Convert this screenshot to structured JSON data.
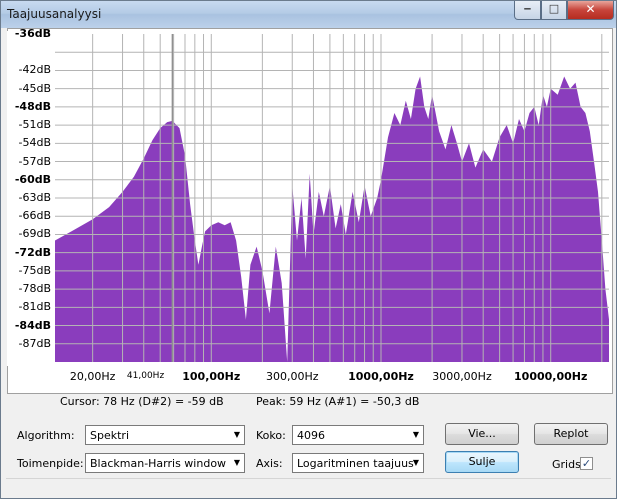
{
  "window": {
    "title": "Taajuusanalyysi",
    "minimize_glyph": "‒",
    "maximize_glyph": "□",
    "close_glyph": "✕"
  },
  "plot": {
    "fill_color": "#8a3dbd",
    "grid_color": "#b4b4b4",
    "y_ticks": [
      {
        "label": "-36dB",
        "bold": true
      },
      {
        "label": "-42dB",
        "bold": false
      },
      {
        "label": "-45dB",
        "bold": false
      },
      {
        "label": "-48dB",
        "bold": true
      },
      {
        "label": "-51dB",
        "bold": false
      },
      {
        "label": "-54dB",
        "bold": false
      },
      {
        "label": "-57dB",
        "bold": false
      },
      {
        "label": "-60dB",
        "bold": true
      },
      {
        "label": "-63dB",
        "bold": false
      },
      {
        "label": "-66dB",
        "bold": false
      },
      {
        "label": "-69dB",
        "bold": false
      },
      {
        "label": "-72dB",
        "bold": true
      },
      {
        "label": "-75dB",
        "bold": false
      },
      {
        "label": "-78dB",
        "bold": false
      },
      {
        "label": "-81dB",
        "bold": false
      },
      {
        "label": "-84dB",
        "bold": true
      },
      {
        "label": "-87dB",
        "bold": false
      }
    ],
    "x_ticks": [
      {
        "label": "20,00Hz",
        "style": "normal",
        "freq": 20
      },
      {
        "label": "41,00Hz",
        "style": "small",
        "freq": 41
      },
      {
        "label": "100,00Hz",
        "style": "bold",
        "freq": 100
      },
      {
        "label": "300,00Hz",
        "style": "normal",
        "freq": 300
      },
      {
        "label": "1000,00Hz",
        "style": "bold",
        "freq": 1000
      },
      {
        "label": "3000,00Hz",
        "style": "normal",
        "freq": 3000
      },
      {
        "label": "10000,00Hz",
        "style": "bold",
        "freq": 10000
      }
    ]
  },
  "chart_data": {
    "type": "area",
    "x_scale": "log",
    "x_range_hz": [
      12,
      22050
    ],
    "y_range_db": [
      -90,
      -36
    ],
    "grid": true,
    "cursor_freq_hz": 59,
    "spectrum": [
      [
        12,
        -70
      ],
      [
        15,
        -68.5
      ],
      [
        20,
        -66.5
      ],
      [
        25,
        -64.5
      ],
      [
        30,
        -62
      ],
      [
        35,
        -59.5
      ],
      [
        40,
        -56.5
      ],
      [
        45,
        -53.5
      ],
      [
        50,
        -51.5
      ],
      [
        55,
        -50.5
      ],
      [
        59,
        -50.3
      ],
      [
        65,
        -51.5
      ],
      [
        70,
        -56
      ],
      [
        75,
        -64
      ],
      [
        80,
        -70
      ],
      [
        84,
        -74
      ],
      [
        88,
        -71
      ],
      [
        92,
        -68.5
      ],
      [
        100,
        -67.5
      ],
      [
        110,
        -67
      ],
      [
        120,
        -67.5
      ],
      [
        130,
        -67
      ],
      [
        140,
        -70
      ],
      [
        150,
        -76
      ],
      [
        160,
        -83
      ],
      [
        170,
        -74
      ],
      [
        185,
        -71
      ],
      [
        200,
        -75
      ],
      [
        220,
        -82
      ],
      [
        240,
        -71
      ],
      [
        260,
        -77
      ],
      [
        280,
        -90
      ],
      [
        300,
        -61
      ],
      [
        320,
        -70
      ],
      [
        340,
        -63
      ],
      [
        360,
        -73
      ],
      [
        380,
        -59
      ],
      [
        400,
        -69
      ],
      [
        430,
        -62
      ],
      [
        460,
        -66
      ],
      [
        500,
        -61
      ],
      [
        540,
        -68
      ],
      [
        580,
        -64
      ],
      [
        620,
        -69
      ],
      [
        680,
        -62
      ],
      [
        740,
        -67
      ],
      [
        800,
        -61
      ],
      [
        870,
        -66
      ],
      [
        950,
        -63
      ],
      [
        1000,
        -60
      ],
      [
        1100,
        -53
      ],
      [
        1200,
        -49
      ],
      [
        1300,
        -51
      ],
      [
        1400,
        -47
      ],
      [
        1500,
        -50
      ],
      [
        1600,
        -45
      ],
      [
        1700,
        -43
      ],
      [
        1800,
        -48
      ],
      [
        1900,
        -50
      ],
      [
        2000,
        -46
      ],
      [
        2200,
        -52
      ],
      [
        2400,
        -55
      ],
      [
        2600,
        -51
      ],
      [
        2800,
        -54
      ],
      [
        3000,
        -57
      ],
      [
        3300,
        -54
      ],
      [
        3600,
        -58
      ],
      [
        4000,
        -55
      ],
      [
        4500,
        -57
      ],
      [
        5000,
        -53
      ],
      [
        5500,
        -51
      ],
      [
        6000,
        -54
      ],
      [
        6500,
        -50
      ],
      [
        7000,
        -52
      ],
      [
        7500,
        -49
      ],
      [
        8000,
        -48
      ],
      [
        8500,
        -51
      ],
      [
        9000,
        -46
      ],
      [
        9500,
        -48
      ],
      [
        10000,
        -45
      ],
      [
        11000,
        -46
      ],
      [
        12000,
        -43
      ],
      [
        13000,
        -45
      ],
      [
        14000,
        -44
      ],
      [
        15000,
        -48
      ],
      [
        16000,
        -49
      ],
      [
        17000,
        -52
      ],
      [
        18000,
        -57
      ],
      [
        19000,
        -62
      ],
      [
        20000,
        -70
      ],
      [
        21000,
        -78
      ],
      [
        22050,
        -83
      ]
    ]
  },
  "info": {
    "cursor": "Cursor: 78 Hz (D#2) = -59 dB",
    "peak": "Peak: 59 Hz (A#1) = -50,3 dB"
  },
  "controls": {
    "algorithm_label": "Algorithm:",
    "algorithm_value": "Spektri",
    "function_label": "Toimenpide:",
    "function_value": "Blackman-Harris window",
    "size_label": "Koko:",
    "size_value": "4096",
    "axis_label": "Axis:",
    "axis_value": "Logaritminen taajuus",
    "export_button": "Vie...",
    "replot_button": "Replot",
    "close_button": "Sulje",
    "grids_label": "Grids",
    "grids_checked": true,
    "check_glyph": "✓",
    "dropdown_glyph": "▼"
  }
}
